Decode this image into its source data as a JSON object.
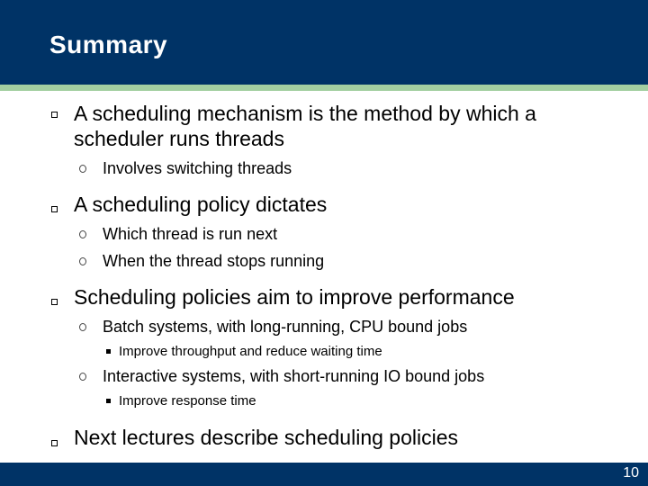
{
  "slide": {
    "title": "Summary",
    "page_number": "10",
    "colors": {
      "header": "#003366",
      "accent_stripe": "#a3cfa1",
      "footer": "#003366"
    }
  },
  "bullets": [
    {
      "text_line1": "A scheduling mechanism is the method by which a",
      "text_line2": "scheduler runs threads"
    },
    {
      "text": "Involves switching threads"
    },
    {
      "text": "A scheduling policy dictates"
    },
    {
      "text": "Which thread is run next"
    },
    {
      "text": "When the thread stops running"
    },
    {
      "text": "Scheduling policies aim to improve performance"
    },
    {
      "text": "Batch systems, with long-running, CPU bound jobs"
    },
    {
      "text": "Improve throughput and reduce waiting time"
    },
    {
      "text": "Interactive systems, with short-running IO bound jobs"
    },
    {
      "text": "Improve response time"
    },
    {
      "text": "Next lectures describe scheduling policies"
    }
  ]
}
